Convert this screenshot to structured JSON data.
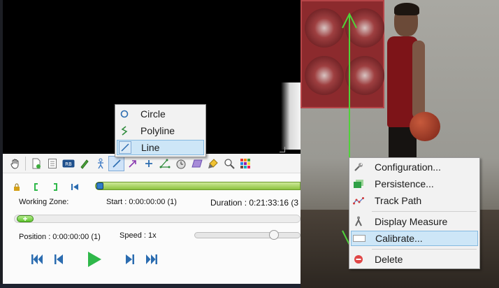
{
  "working_zone": {
    "label": "Working Zone:",
    "start": "Start : 0:00:00:00 (1)",
    "duration": "Duration : 0:21:33:16 (3"
  },
  "playback": {
    "position": "Position : 0:00:00:00 (1)",
    "speed": "Speed : 1x"
  },
  "toolbar": {
    "tools": [
      "hand-tool",
      "new-key-image",
      "comment",
      "label-tool",
      "pencil",
      "posture",
      "line",
      "arrow",
      "cross-marker",
      "angle",
      "chronometer",
      "rectangle",
      "highlighter",
      "magnifier",
      "color-grid"
    ],
    "badge_text": "RB"
  },
  "line_submenu": {
    "items": [
      {
        "label": "Circle",
        "icon": "circle-icon"
      },
      {
        "label": "Polyline",
        "icon": "polyline-icon"
      },
      {
        "label": "Line",
        "icon": "line-icon",
        "highlighted": true
      }
    ]
  },
  "context_menu": {
    "items": [
      {
        "label": "Configuration...",
        "icon": "wrench-icon"
      },
      {
        "label": "Persistence...",
        "icon": "persistence-icon"
      },
      {
        "label": "Track Path",
        "icon": "track-path-icon"
      },
      {
        "label": "Display Measure",
        "icon": "measure-icon"
      },
      {
        "label": "Calibrate...",
        "icon": "calibrate-icon",
        "highlighted": true
      },
      {
        "label": "Delete",
        "icon": "delete-icon"
      }
    ]
  },
  "colors": {
    "accent_green": "#2fb84a",
    "measure_line": "#4fd23a",
    "highlight": "#cde6f7"
  }
}
